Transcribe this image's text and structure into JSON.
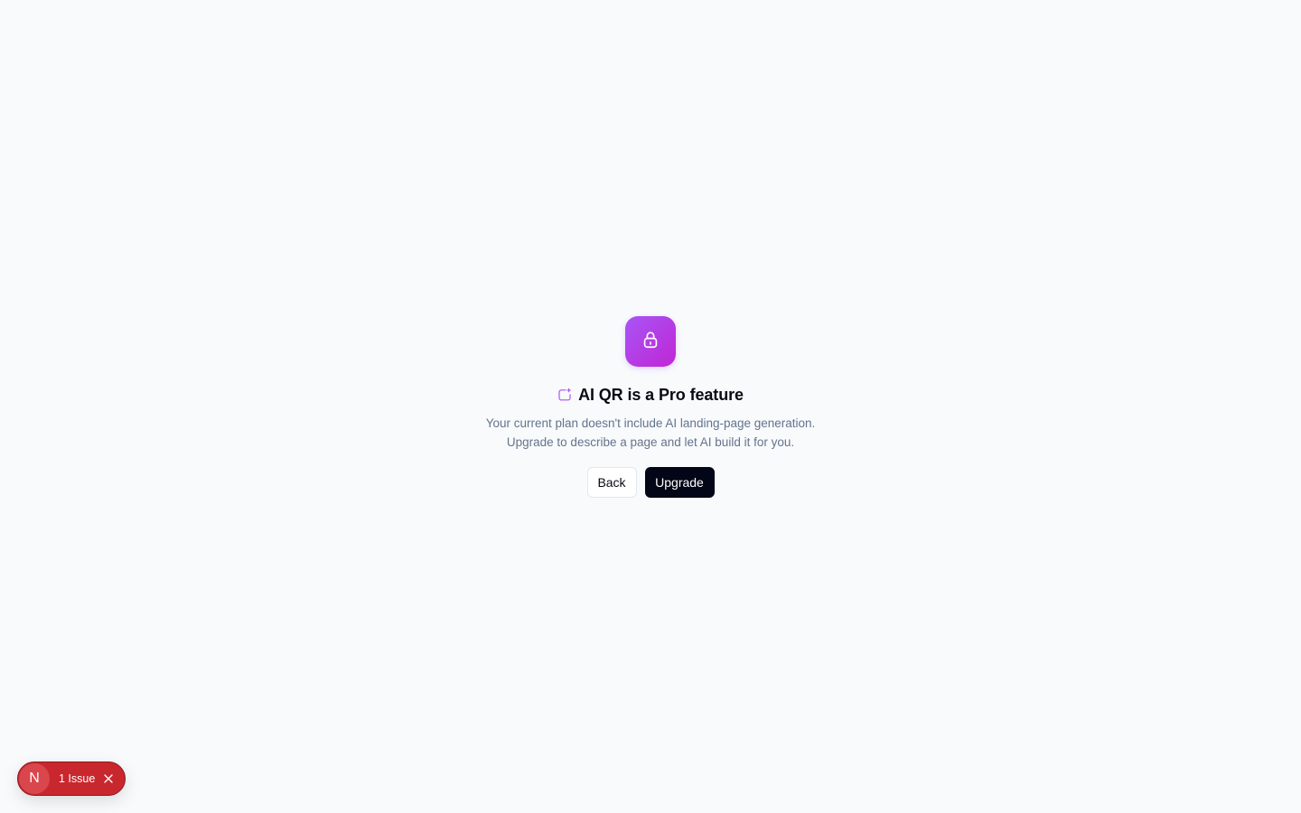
{
  "gate": {
    "lock_icon": "lock-icon",
    "title_icon": "sparkle-square-icon",
    "title": "AI QR is a Pro feature",
    "description_line_1": "Your current plan doesn't include AI landing-page generation.",
    "description_line_2": "Upgrade to describe a page and let AI build it for you.",
    "back_label": "Back",
    "upgrade_label": "Upgrade"
  },
  "dev_overlay": {
    "logo_letter": "N",
    "issue_label": "1 Issue",
    "close_icon": "close-icon"
  },
  "colors": {
    "background": "#f8fafc",
    "accent_gradient_start": "#a855f7",
    "accent_gradient_end": "#c026d3",
    "primary_button": "#020617",
    "issue_badge": "#c9272e"
  }
}
